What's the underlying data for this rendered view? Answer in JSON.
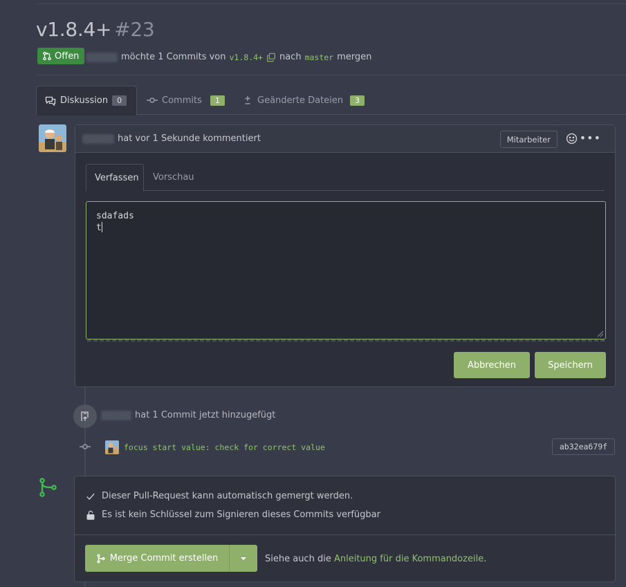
{
  "header": {
    "title": "v1.8.4+",
    "number": "#23",
    "status": "Offen",
    "subline_pre": "möchte 1 Commits von",
    "head_branch": "v1.8.4+",
    "subline_mid": "nach",
    "base_branch": "master",
    "subline_post": "mergen"
  },
  "tabs": [
    {
      "label": "Diskussion",
      "count": "0"
    },
    {
      "label": "Commits",
      "count": "1"
    },
    {
      "label": "Geänderte Dateien",
      "count": "3"
    }
  ],
  "comment": {
    "meta": "hat vor 1 Sekunde kommentiert",
    "role": "Mitarbeiter",
    "edit_tabs": [
      "Verfassen",
      "Vorschau"
    ],
    "text_lines": [
      "sdafads",
      "t"
    ],
    "cancel_label": "Abbrechen",
    "save_label": "Speichern"
  },
  "event": {
    "text": "hat 1 Commit jetzt hinzugefügt",
    "commit_message": "focus start value: check for correct value",
    "commit_sha": "ab32ea679f"
  },
  "merge": {
    "line1": "Dieser Pull-Request kann automatisch gemergt werden.",
    "line2": "Es ist kein Schlüssel zum Signieren dieses Commits verfügbar",
    "button_label": "Merge Commit erstellen",
    "see_also_pre": "Siehe auch die",
    "see_also_link": "Anleitung für die Kommandozeile",
    "see_also_post": "."
  },
  "colors": {
    "accent": "#8fb06a",
    "open_badge": "#3d8b40",
    "branch_text": "#8fc36a",
    "background": "#383c4a"
  }
}
